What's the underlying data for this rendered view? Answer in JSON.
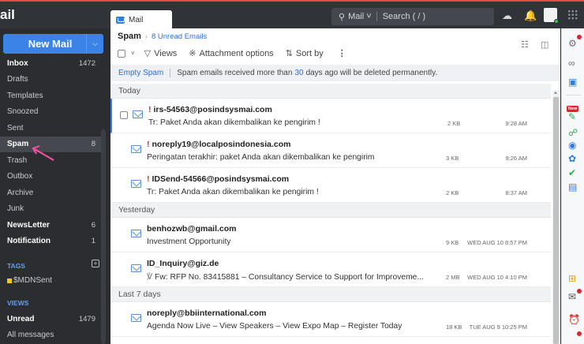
{
  "topbar": {
    "app_name": "ail",
    "tab_label": "Mail",
    "search_scope": "Mail",
    "search_placeholder": "Search ( / )"
  },
  "sidebar": {
    "new_mail_label": "New Mail",
    "folders": [
      {
        "name": "Inbox",
        "count": "1472",
        "bold": true,
        "selected": false
      },
      {
        "name": "Drafts",
        "count": "",
        "bold": false,
        "selected": false
      },
      {
        "name": "Templates",
        "count": "",
        "bold": false,
        "selected": false
      },
      {
        "name": "Snoozed",
        "count": "",
        "bold": false,
        "selected": false
      },
      {
        "name": "Sent",
        "count": "",
        "bold": false,
        "selected": false
      },
      {
        "name": "Spam",
        "count": "8",
        "bold": true,
        "selected": true
      },
      {
        "name": "Trash",
        "count": "",
        "bold": false,
        "selected": false
      },
      {
        "name": "Outbox",
        "count": "",
        "bold": false,
        "selected": false
      },
      {
        "name": "Archive",
        "count": "",
        "bold": false,
        "selected": false
      },
      {
        "name": "Junk",
        "count": "",
        "bold": false,
        "selected": false
      },
      {
        "name": "NewsLetter",
        "count": "6",
        "bold": true,
        "selected": false
      },
      {
        "name": "Notification",
        "count": "1",
        "bold": true,
        "selected": false
      }
    ],
    "tags_heading": "TAGS",
    "tag_add": "+",
    "tags": [
      {
        "name": "$MDNSent",
        "color": "#f2c811"
      }
    ],
    "views_heading": "VIEWS",
    "views": [
      {
        "name": "Unread",
        "count": "1479",
        "bold": true
      },
      {
        "name": "All messages",
        "count": "",
        "bold": false
      }
    ]
  },
  "main": {
    "folder_title": "Spam",
    "crumb_sep": "›",
    "unread_label": "8 Unread Emails",
    "toolbar": {
      "views_label": "Views",
      "attachment_label": "Attachment options",
      "sort_label": "Sort by",
      "more_label": "⋮"
    },
    "notice": {
      "empty_label": "Empty Spam",
      "text_before": "Spam emails received more than",
      "days": "30",
      "text_after": "days ago will be deleted permanently."
    },
    "groups": [
      {
        "label": "Today",
        "rows": [
          {
            "from": "irs-54563@posindsysmai.com",
            "flag": "!",
            "subject": "Tr: Paket Anda akan dikembalikan ke pengirim !",
            "attachment": false,
            "size": "2 KB",
            "time": "9:28 AM",
            "active": true
          },
          {
            "from": "noreply19@localposindonesia.com",
            "flag": "!",
            "subject": "Peringatan terakhir: paket Anda akan dikembalikan ke pengirim",
            "attachment": false,
            "size": "3 KB",
            "time": "9:26 AM",
            "active": false
          },
          {
            "from": "IDSend-54566@posindsysmai.com",
            "flag": "!",
            "subject": "Tr: Paket Anda akan dikembalikan ke pengirim !",
            "attachment": false,
            "size": "2 KB",
            "time": "8:37 AM",
            "active": false
          }
        ]
      },
      {
        "label": "Yesterday",
        "rows": [
          {
            "from": "benhozwb@gmail.com",
            "flag": "",
            "subject": "Investment Opportunity",
            "attachment": false,
            "size": "9 KB",
            "time": "WED AUG 10 8:57 PM",
            "active": false
          },
          {
            "from": "ID_Inquiry@giz.de",
            "flag": "",
            "subject": "Fw: RFP No. 83415881 – Consultancy Service to Support for Improveme...",
            "attachment": true,
            "size": "2 MB",
            "time": "WED AUG 10 4:10 PM",
            "active": false
          }
        ]
      },
      {
        "label": "Last 7 days",
        "rows": [
          {
            "from": "noreply@bbiinternational.com",
            "flag": "",
            "subject": "Agenda Now Live – View Speakers – View Expo Map – Register Today",
            "attachment": false,
            "size": "18 KB",
            "time": "TUE AUG 9 10:25 PM",
            "active": false
          }
        ]
      }
    ]
  },
  "rail": {
    "new_badge": "New"
  },
  "colors": {
    "accent": "#3b83e7",
    "spam_flag": "#e0242a",
    "topbar_border": "#e14b3b"
  }
}
